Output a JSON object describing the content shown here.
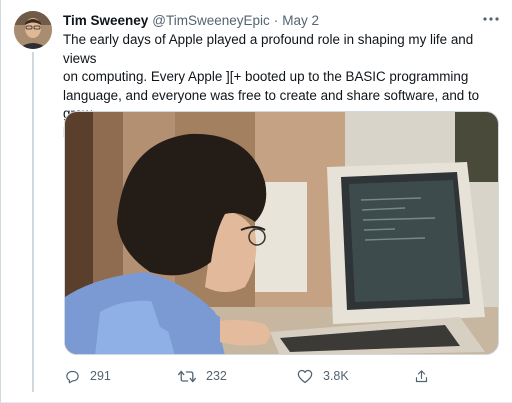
{
  "tweet": {
    "author": {
      "display_name": "Tim Sweeney",
      "handle": "@TimSweeneyEpic"
    },
    "separator": "·",
    "date": "May 2",
    "text": "The early days of Apple played a profound role in shaping my life and views\non computing. Every Apple ][+ booted up to the BASIC programming\nlanguage, and everyone was free to create and share software, and to grow\nbusinesses on their own volition.",
    "media_alt_icon": "photo-of-child-at-apple-computer",
    "stats": {
      "replies": "291",
      "retweets": "232",
      "likes": "3.8K"
    },
    "icons": {
      "reply": "reply-icon",
      "retweet": "retweet-icon",
      "like": "heart-icon",
      "share": "share-icon",
      "more": "more-icon"
    },
    "colors": {
      "text": "#0f1419",
      "secondary": "#536471",
      "border": "#cfd9de"
    }
  }
}
